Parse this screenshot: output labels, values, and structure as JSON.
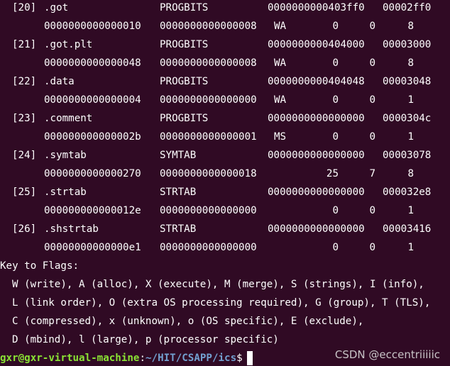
{
  "colors": {
    "background": "#300a24",
    "text": "#ffffff",
    "prompt_user": "#8ae234",
    "prompt_path": "#729fcf"
  },
  "sections": [
    {
      "row1": {
        "idx": "[20]",
        "name": ".got",
        "type": "PROGBITS",
        "address": "0000000000403ff0",
        "offset": "00002ff0"
      },
      "row2": {
        "size": "0000000000000010",
        "entsize": "0000000000000008",
        "flags": "WA",
        "link": "0",
        "info": "0",
        "align": "8"
      }
    },
    {
      "row1": {
        "idx": "[21]",
        "name": ".got.plt",
        "type": "PROGBITS",
        "address": "0000000000404000",
        "offset": "00003000"
      },
      "row2": {
        "size": "0000000000000048",
        "entsize": "0000000000000008",
        "flags": "WA",
        "link": "0",
        "info": "0",
        "align": "8"
      }
    },
    {
      "row1": {
        "idx": "[22]",
        "name": ".data",
        "type": "PROGBITS",
        "address": "0000000000404048",
        "offset": "00003048"
      },
      "row2": {
        "size": "0000000000000004",
        "entsize": "0000000000000000",
        "flags": "WA",
        "link": "0",
        "info": "0",
        "align": "1"
      }
    },
    {
      "row1": {
        "idx": "[23]",
        "name": ".comment",
        "type": "PROGBITS",
        "address": "0000000000000000",
        "offset": "0000304c"
      },
      "row2": {
        "size": "000000000000002b",
        "entsize": "0000000000000001",
        "flags": "MS",
        "link": "0",
        "info": "0",
        "align": "1"
      }
    },
    {
      "row1": {
        "idx": "[24]",
        "name": ".symtab",
        "type": "SYMTAB",
        "address": "0000000000000000",
        "offset": "00003078"
      },
      "row2": {
        "size": "0000000000000270",
        "entsize": "0000000000000018",
        "flags": "",
        "link": "25",
        "info": "7",
        "align": "8"
      }
    },
    {
      "row1": {
        "idx": "[25]",
        "name": ".strtab",
        "type": "STRTAB",
        "address": "0000000000000000",
        "offset": "000032e8"
      },
      "row2": {
        "size": "000000000000012e",
        "entsize": "0000000000000000",
        "flags": "",
        "link": "0",
        "info": "0",
        "align": "1"
      }
    },
    {
      "row1": {
        "idx": "[26]",
        "name": ".shstrtab",
        "type": "STRTAB",
        "address": "0000000000000000",
        "offset": "00003416"
      },
      "row2": {
        "size": "00000000000000e1",
        "entsize": "0000000000000000",
        "flags": "",
        "link": "0",
        "info": "0",
        "align": "1"
      }
    }
  ],
  "key_to_flags": {
    "title": "Key to Flags:",
    "lines": [
      "W (write), A (alloc), X (execute), M (merge), S (strings), I (info),",
      "L (link order), O (extra OS processing required), G (group), T (TLS),",
      "C (compressed), x (unknown), o (OS specific), E (exclude),",
      "D (mbind), l (large), p (processor specific)"
    ]
  },
  "prompt": {
    "user_host": "gxr@gxr-virtual-machine",
    "separator": ":",
    "path": "~/HIT/CSAPP/ics",
    "dollar": "$"
  },
  "watermark": "CSDN @eccentriiiiic"
}
